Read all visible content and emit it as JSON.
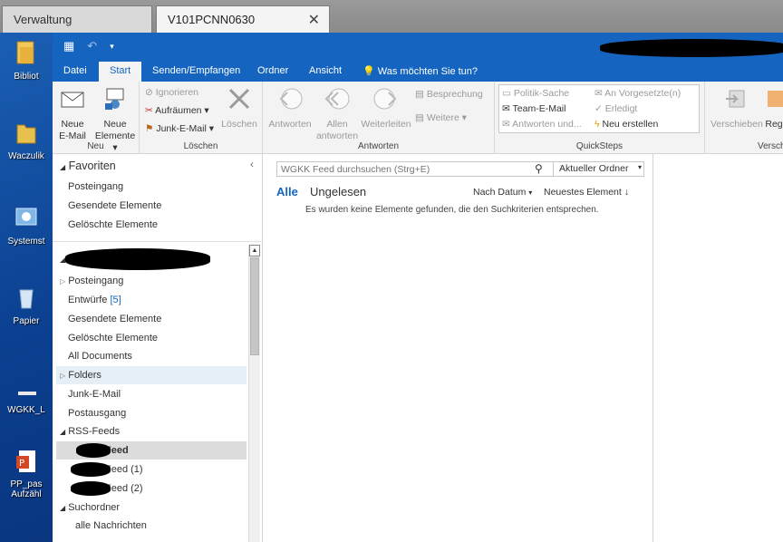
{
  "tabs": [
    {
      "label": "Verwaltung"
    },
    {
      "label": "V101PCNN0630",
      "close": "✕"
    }
  ],
  "desktop_icons": [
    {
      "label": "Bibliot"
    },
    {
      "label": "Waczulik"
    },
    {
      "label": "Systemst"
    },
    {
      "label": "Papier"
    },
    {
      "label": "WGKK_L"
    },
    {
      "label": "PP_pas",
      "label2": "Aufzähl"
    }
  ],
  "ribbon_tabs": [
    "Datei",
    "Start",
    "Senden/Empfangen",
    "Ordner",
    "Ansicht",
    "Was möchten Sie tun?"
  ],
  "ribbon": {
    "neu": {
      "group": "Neu",
      "new_email": [
        "Neue",
        "E-Mail"
      ],
      "new_items": [
        "Neue",
        "Elemente ▾"
      ]
    },
    "loeschen": {
      "group": "Löschen",
      "ignore": "Ignorieren",
      "cleanup": "Aufräumen ▾",
      "junk": "Junk-E-Mail ▾",
      "delete": "Löschen"
    },
    "antworten": {
      "group": "Antworten",
      "reply": "Antworten",
      "reply_all": [
        "Allen",
        "antworten"
      ],
      "forward": "Weiterleiten",
      "meeting": "Besprechung",
      "more": "Weitere ▾"
    },
    "quicksteps": {
      "group": "QuickSteps",
      "items": [
        "Politik-Sache",
        "Team-E-Mail",
        "Antworten und...",
        "An Vorgesetzte(n)",
        "Erledigt",
        "Neu erstellen"
      ]
    },
    "verschieben": {
      "group": "Verschie",
      "move": "Verschieben",
      "rules": "Reg"
    }
  },
  "folders": {
    "favorites_header": "Favoriten",
    "favorites": [
      "Posteingang",
      "Gesendete Elemente",
      "Gelöschte Elemente"
    ],
    "inbox": "Posteingang",
    "drafts": "Entwürfe",
    "drafts_count": "[5]",
    "sent": "Gesendete Elemente",
    "deleted": "Gelöschte Elemente",
    "all_docs": "All Documents",
    "folders_node": "Folders",
    "junk": "Junk-E-Mail",
    "outbox": "Postausgang",
    "rss": "RSS-Feeds",
    "feeds": [
      "Feed",
      "Feed (1)",
      "Feed (2)"
    ],
    "search_folders": "Suchordner",
    "all_messages": "alle Nachrichten"
  },
  "message_list": {
    "search_placeholder": "WGKK Feed durchsuchen (Strg+E)",
    "scope": "Aktueller Ordner",
    "filter_all": "Alle",
    "filter_unread": "Ungelesen",
    "sort_by": "Nach Datum",
    "sort_order": "Neuestes Element",
    "empty_message": "Es wurden keine Elemente gefunden, die den Suchkriterien entsprechen."
  },
  "colors": {
    "brand": "#1565c0",
    "ribbon_bg": "#f3f3f3",
    "selected_feed": "#dcdcdc"
  }
}
